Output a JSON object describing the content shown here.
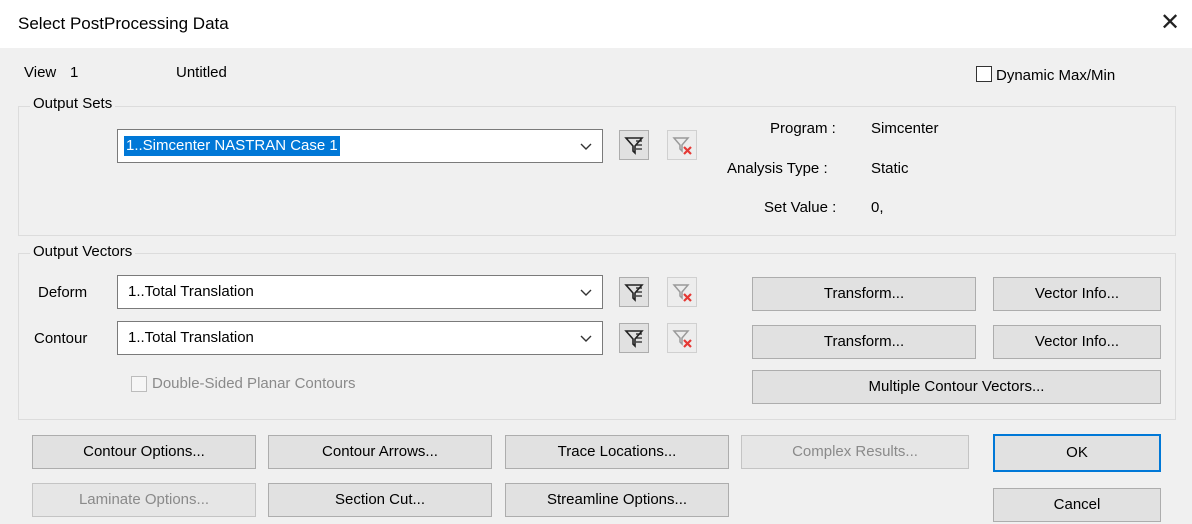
{
  "window": {
    "title": "Select PostProcessing Data",
    "close_glyph": "✕"
  },
  "view": {
    "label": "View",
    "number": "1",
    "name": "Untitled"
  },
  "dynamic_maxmin": {
    "label": "Dynamic Max/Min",
    "checked": false
  },
  "output_sets": {
    "group_label": "Output Sets",
    "selected": "1..Simcenter NASTRAN Case 1",
    "program_label": "Program :",
    "program_value": "Simcenter",
    "analysis_type_label": "Analysis Type :",
    "analysis_type_value": "Static",
    "set_value_label": "Set Value :",
    "set_value_value": "0,"
  },
  "output_vectors": {
    "group_label": "Output Vectors",
    "deform_label": "Deform",
    "deform_selected": "1..Total Translation",
    "contour_label": "Contour",
    "contour_selected": "1..Total Translation",
    "double_sided_label": "Double-Sided Planar Contours",
    "transform_label": "Transform...",
    "vector_info_label": "Vector Info...",
    "multiple_contour_label": "Multiple Contour Vectors..."
  },
  "buttons": {
    "contour_options": "Contour Options...",
    "contour_arrows": "Contour Arrows...",
    "trace_locations": "Trace Locations...",
    "complex_results": "Complex Results...",
    "laminate_options": "Laminate Options...",
    "section_cut": "Section Cut...",
    "streamline_options": "Streamline Options...",
    "ok": "OK",
    "cancel": "Cancel"
  },
  "icons": {
    "filter": "filter-icon",
    "clear_filter": "clear-filter-icon",
    "dropdown": "chevron-down-icon",
    "close": "close-icon"
  },
  "colors": {
    "selection": "#0078d7",
    "filter_red": "#e53935",
    "dialog_bg": "#f0f0f0"
  }
}
